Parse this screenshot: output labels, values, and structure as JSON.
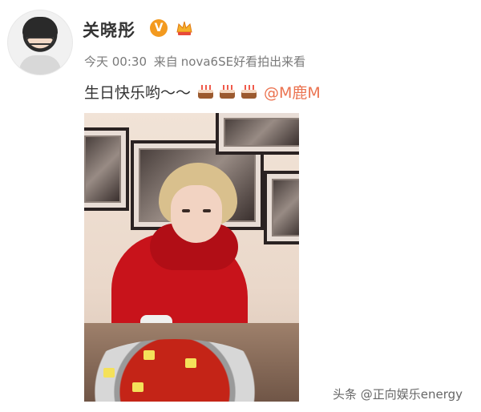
{
  "user": {
    "name": "关晓彤",
    "verified_badge": "V"
  },
  "meta": {
    "time": "今天 00:30",
    "source_prefix": "来自",
    "source": "nova6SE好看拍出来看"
  },
  "post": {
    "text": "生日快乐哟～～",
    "emoji": [
      "cake-icon",
      "cake-icon",
      "cake-icon"
    ],
    "mention": "@M鹿M"
  },
  "watermark": "头条 @正向娱乐energy",
  "colors": {
    "mention": "#eb7350",
    "verified": "#f39a1f",
    "meta_text": "#7a7a7a"
  }
}
